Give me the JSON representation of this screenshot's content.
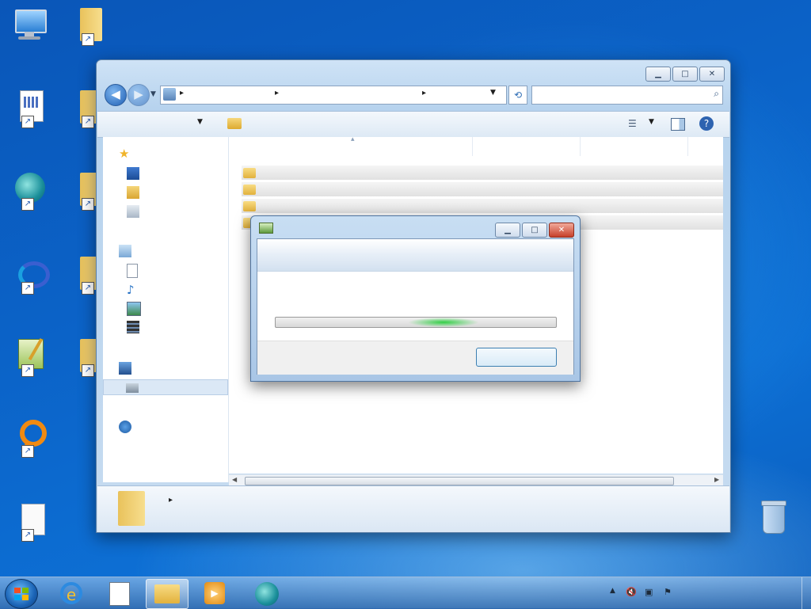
{
  "desktop": {
    "icons": [
      {
        "id": "computer",
        "label": ""
      },
      {
        "id": "folder-1",
        "label": ""
      },
      {
        "id": "document",
        "label": ""
      },
      {
        "id": "folder-2",
        "label": ""
      },
      {
        "id": "browser-app",
        "label": ""
      },
      {
        "id": "folder-3",
        "label": ""
      },
      {
        "id": "app-blue",
        "label": ""
      },
      {
        "id": "folder-4",
        "label": ""
      },
      {
        "id": "notepad-app",
        "label": ""
      },
      {
        "id": "folder-5",
        "label": ""
      },
      {
        "id": "orange-app",
        "label": ""
      },
      {
        "id": "blank-file",
        "label": ""
      },
      {
        "id": "recycle-bin",
        "label": ""
      }
    ]
  },
  "explorer": {
    "address": {
      "segment_1": "",
      "segment_2": ""
    },
    "search": {
      "placeholder": ""
    },
    "toolbar": {
      "organize": "",
      "include": "",
      "share": "",
      "new_folder": ""
    },
    "nav": {
      "favorites": "",
      "desktop": "",
      "downloads": "",
      "recent": "",
      "libraries": "",
      "documents": "",
      "music": "",
      "pictures": "",
      "videos": "",
      "computer": "",
      "drive": "",
      "network": ""
    },
    "columns": {
      "name": "",
      "date": "",
      "type": "",
      "size": ""
    },
    "rows": [
      {
        "name": "",
        "date": "",
        "type": ""
      },
      {
        "name": "",
        "date": "",
        "type": ""
      },
      {
        "name": "",
        "date": "",
        "type": ""
      },
      {
        "name": "",
        "date": "",
        "type": ""
      }
    ],
    "details_text": ""
  },
  "copy_dialog": {
    "title": "",
    "header_text": "",
    "status_line_1": "",
    "status_line_2": "",
    "progress": 0.6,
    "cancel_label": ""
  },
  "taskbar": {
    "clock_time": "",
    "clock_date": ""
  },
  "colors": {
    "accent": "#1b64b6",
    "progress": "#28cd3c"
  }
}
